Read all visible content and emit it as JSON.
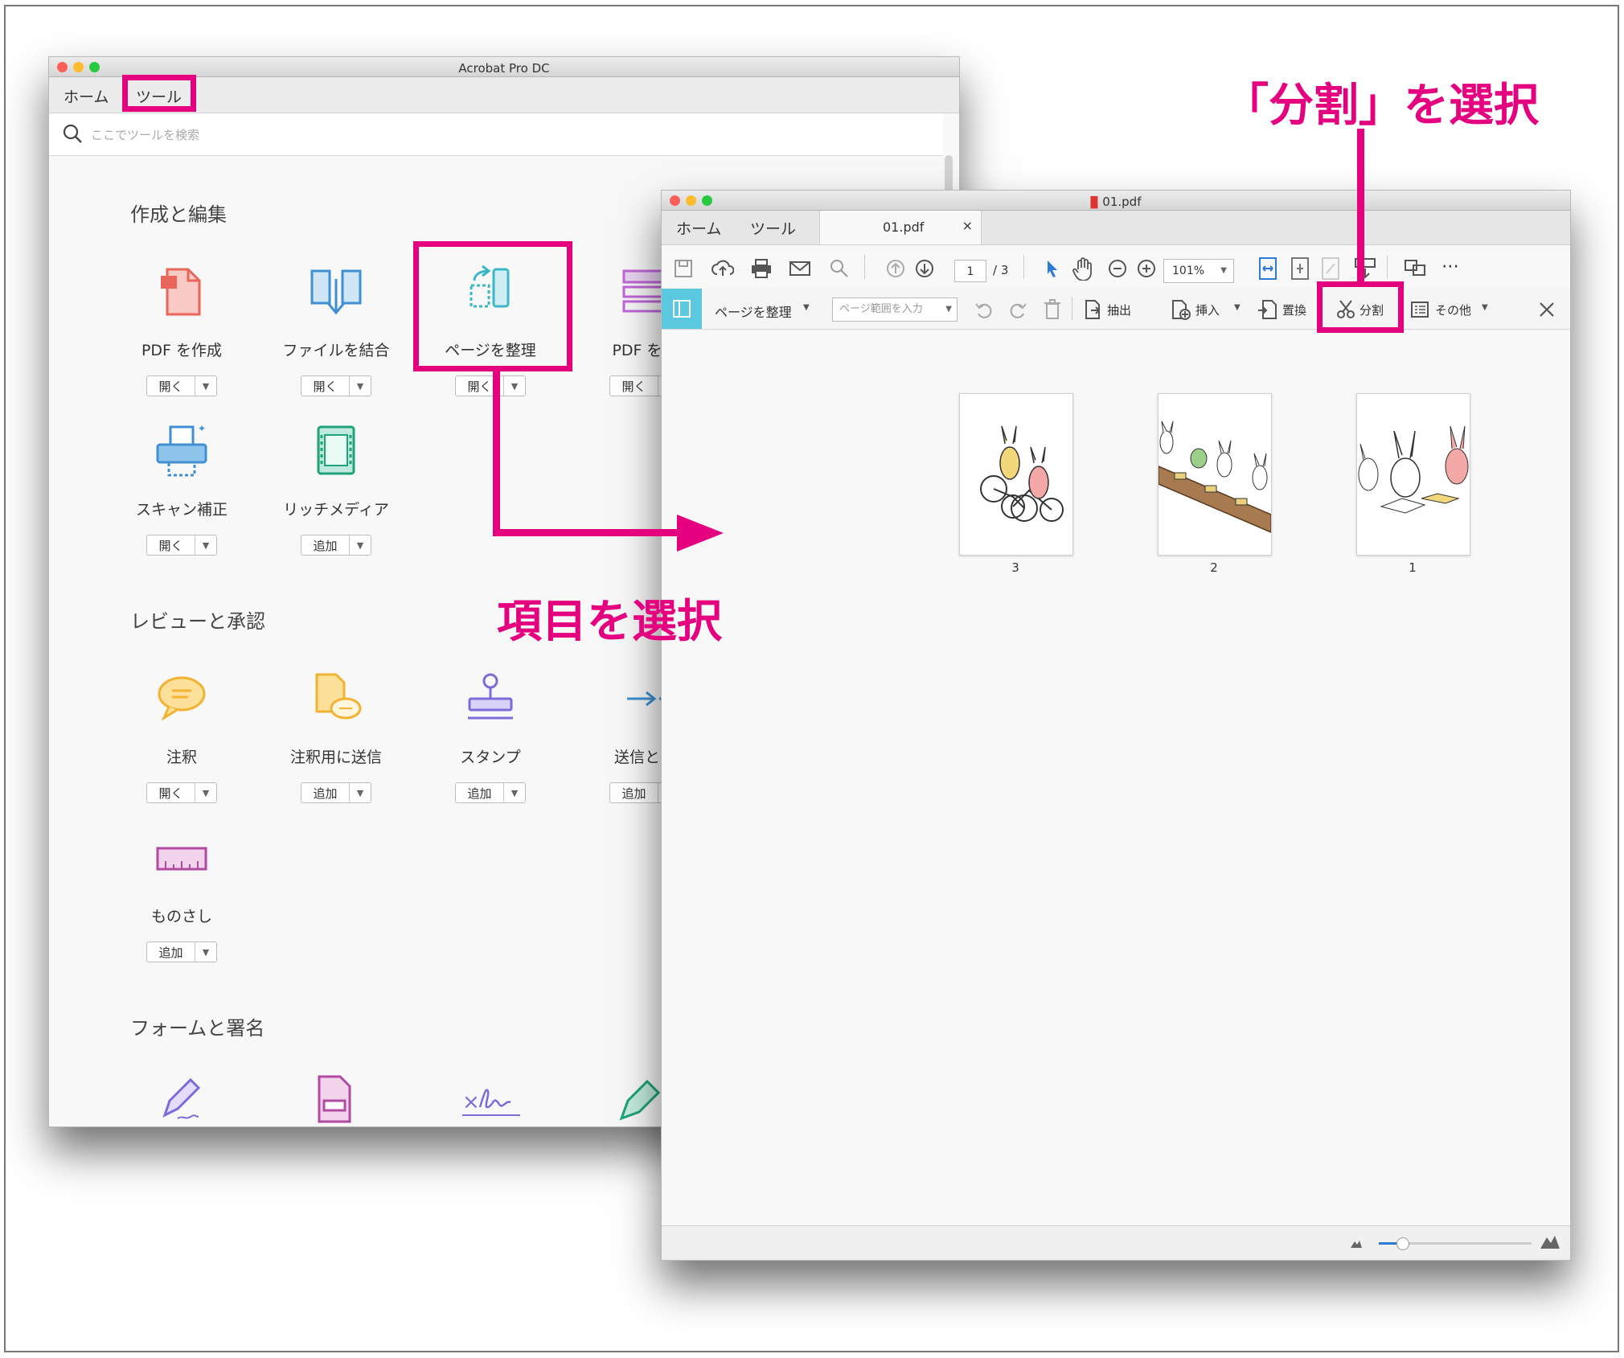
{
  "left_window": {
    "title": "Acrobat Pro DC",
    "nav": {
      "home": "ホーム",
      "tools": "ツール"
    },
    "search_placeholder": "ここでツールを検索",
    "sections": [
      {
        "title": "作成と編集",
        "tools": [
          {
            "label": "PDF を作成",
            "button": "開く",
            "icon": "create-pdf-icon"
          },
          {
            "label": "ファイルを結合",
            "button": "開く",
            "icon": "combine-files-icon"
          },
          {
            "label": "ページを整理",
            "button": "開く",
            "icon": "organize-pages-icon"
          },
          {
            "label": "PDF を編",
            "button": "開く",
            "icon": "edit-pdf-icon"
          },
          {
            "label": "スキャン補正",
            "button": "開く",
            "icon": "scan-icon"
          },
          {
            "label": "リッチメディア",
            "button": "追加",
            "icon": "rich-media-icon"
          }
        ]
      },
      {
        "title": "レビューと承認",
        "tools": [
          {
            "label": "注釈",
            "button": "開く",
            "icon": "comment-icon"
          },
          {
            "label": "注釈用に送信",
            "button": "追加",
            "icon": "send-for-comments-icon"
          },
          {
            "label": "スタンプ",
            "button": "追加",
            "icon": "stamp-icon"
          },
          {
            "label": "送信とト",
            "button": "追加",
            "icon": "send-track-icon"
          },
          {
            "label": "ものさし",
            "button": "追加",
            "icon": "measure-icon"
          }
        ]
      },
      {
        "title": "フォームと署名"
      }
    ]
  },
  "right_window": {
    "title": "01.pdf",
    "nav": {
      "home": "ホーム",
      "tools": "ツール"
    },
    "tab": {
      "label": "01.pdf",
      "close": "×"
    },
    "toolbar": {
      "page_current": "1",
      "page_total": "/ 3",
      "zoom": "101%"
    },
    "organize": {
      "mode_label": "ページを整理",
      "range_placeholder": "ページ範囲を入力",
      "extract": "抽出",
      "insert": "挿入",
      "replace": "置換",
      "split": "分割",
      "more": "その他"
    },
    "pages": [
      {
        "number": "3"
      },
      {
        "number": "2"
      },
      {
        "number": "1"
      }
    ]
  },
  "annotations": {
    "select_item": "項目を選択",
    "select_split": "「分割」を選択"
  },
  "colors": {
    "highlight": "#e4007f",
    "accent_blue": "#2d7bd6"
  }
}
